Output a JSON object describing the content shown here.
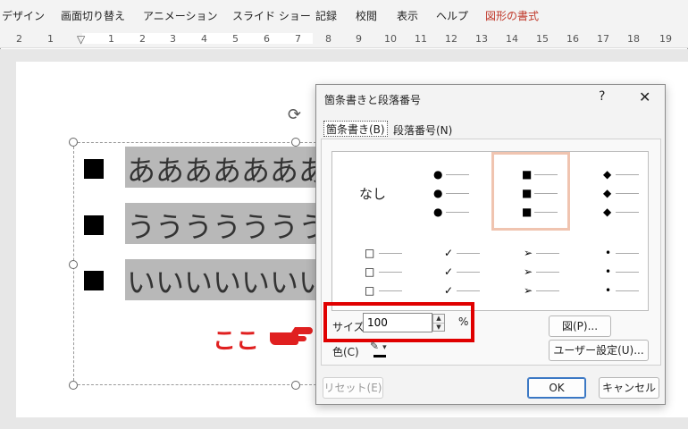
{
  "menu": {
    "items": [
      "デザイン",
      "画面切り替え",
      "アニメーション",
      "スライド ショー",
      "記録",
      "校閲",
      "表示",
      "ヘルプ",
      "図形の書式"
    ],
    "active_color": "#c0392b"
  },
  "ruler": {
    "numbers": [
      "2",
      "1",
      "1",
      "2",
      "3",
      "4",
      "5",
      "6",
      "7",
      "8",
      "9",
      "10",
      "11",
      "12",
      "13",
      "14",
      "15",
      "16",
      "17",
      "18",
      "19"
    ]
  },
  "slide": {
    "lines": [
      "あああああああ",
      "うううううううう",
      "いいいいいいい"
    ],
    "annotation": "ここ",
    "annotation_color": "#e02020"
  },
  "dialog": {
    "title": "箇条書きと段落番号",
    "help": "?",
    "close": "✕",
    "tabs": [
      "箇条書き(B)",
      "段落番号(N)"
    ],
    "none_label": "なし",
    "bullet_glyphs": [
      "●",
      "■",
      "◆",
      "□",
      "✓",
      "➢",
      "•"
    ],
    "size_label": "サイズ(S):",
    "size_value": "100",
    "percent": "%",
    "color_label": "色(C)",
    "picture_button": "図(P)...",
    "custom_button": "ユーザー設定(U)...",
    "reset_button": "リセット(E)",
    "ok_button": "OK",
    "cancel_button": "キャンセル",
    "highlight_color": "#e00000",
    "selected_border_color": "#f0c4b0"
  }
}
